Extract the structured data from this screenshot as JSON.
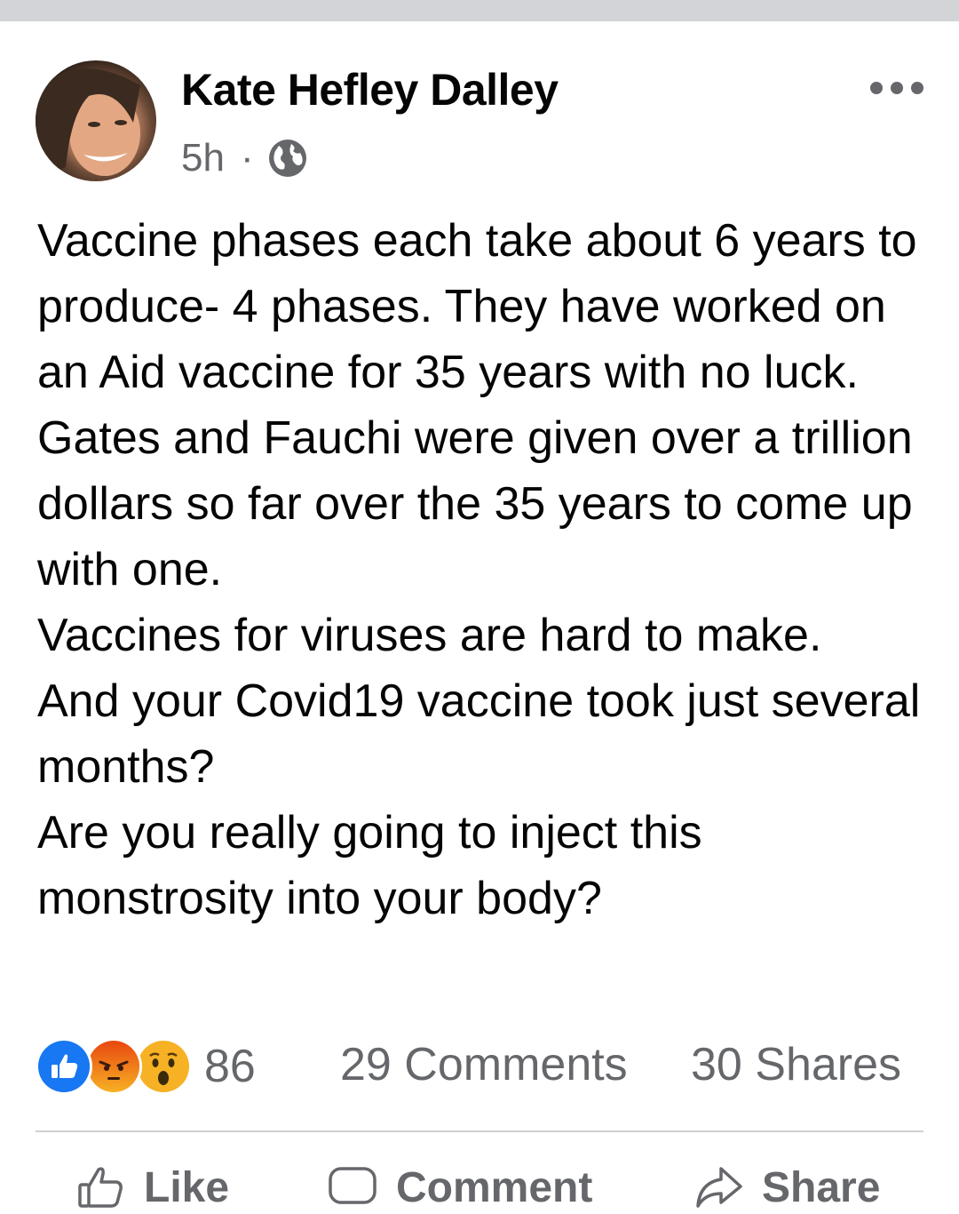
{
  "post": {
    "author": "Kate Hefley Dalley",
    "time": "5h",
    "separator": "·",
    "privacy_icon": "globe-icon",
    "more_icon": "more-options-icon",
    "text_paragraphs": [
      "Vaccine phases each take about 6 years to produce- 4 phases. They have worked on an Aid vaccine for 35 years with no luck. Gates and Fauchi were given over a trillion dollars so far over the 35 years to come up with one.",
      "Vaccines for viruses are hard to make.",
      "And your Covid19 vaccine took just several months?",
      "Are you really going to inject this monstrosity into your body?"
    ]
  },
  "engagement": {
    "reaction_icons": [
      "like-reaction-icon",
      "angry-reaction-icon",
      "wow-reaction-icon"
    ],
    "reaction_count": "86",
    "comments": "29 Comments",
    "shares": "30 Shares"
  },
  "actions": {
    "like": "Like",
    "comment": "Comment",
    "share": "Share"
  },
  "colors": {
    "text": "#050505",
    "secondary": "#65676b",
    "like_blue": "#1877f2",
    "angry_orange": "#e9710f",
    "wow_yellow": "#f7b125",
    "divider": "#ced0d4"
  }
}
